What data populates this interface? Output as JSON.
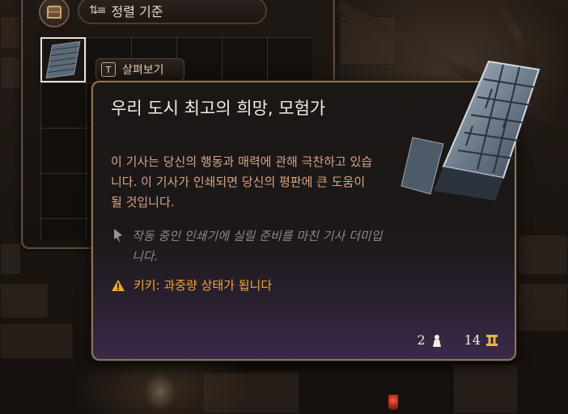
{
  "inventory": {
    "sort_label": "정렬 기준",
    "inspect_key": "T",
    "inspect_label": "살펴보기"
  },
  "tooltip": {
    "title": "우리 도시 최고의 희망, 모험가",
    "description": "이 기사는 당신의 행동과 매력에 관해 극찬하고 있습니다. 이 기사가 인쇄되면 당신의 평판에 큰 도움이 될 것입니다.",
    "flavor": "작동 중인 인쇄기에 실릴 준비를 마친 기사 더미입니다.",
    "warning": "키키: 과중량 상태가 됩니다",
    "weight": "2",
    "value": "14",
    "colors": {
      "warning": "#f2a534",
      "description": "#d4a58a",
      "flavor": "#8e8985",
      "border": "#8d7558"
    }
  },
  "icons": [
    "chest-icon",
    "sort-icon",
    "quill-icon",
    "warning-icon",
    "weight-icon",
    "gold-icon",
    "printing-plate-icon"
  ]
}
